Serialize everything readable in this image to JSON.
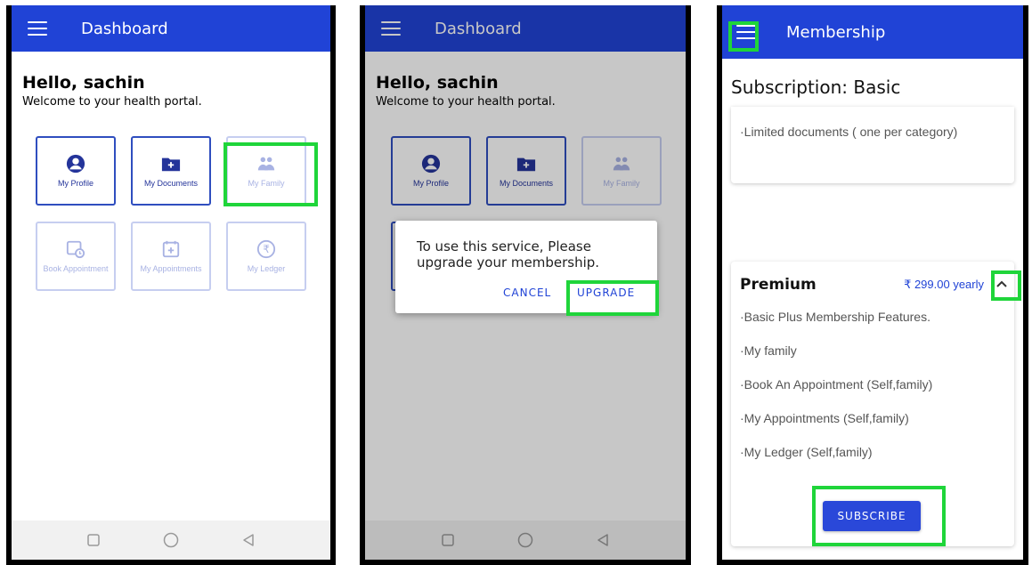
{
  "dashboard": {
    "title": "Dashboard",
    "greeting": "Hello, sachin",
    "welcome": "Welcome to your health portal.",
    "tiles": [
      {
        "label": "My Profile",
        "icon": "person-circle-icon",
        "enabled": true
      },
      {
        "label": "My Documents",
        "icon": "folder-plus-icon",
        "enabled": true
      },
      {
        "label": "My Family",
        "icon": "family-group-icon",
        "enabled": false
      },
      {
        "label": "Book Appointment",
        "icon": "calendar-clock-icon",
        "enabled": false
      },
      {
        "label": "My Appointments",
        "icon": "calendar-plus-icon",
        "enabled": false
      },
      {
        "label": "My Ledger",
        "icon": "rupee-circle-icon",
        "enabled": false
      }
    ]
  },
  "dialog": {
    "message": "To use this service, Please upgrade your membership.",
    "cancel_label": "CANCEL",
    "upgrade_label": "UPGRADE"
  },
  "membership": {
    "title": "Membership",
    "subscription": "Subscription: Basic",
    "basic_feature": "·Limited documents ( one per category)",
    "premium": {
      "name": "Premium",
      "price": "₹ 299.00 yearly",
      "features": [
        "·Basic Plus Membership Features.",
        "·My family",
        "·Book An Appointment (Self,family)",
        "·My Appointments (Self,family)",
        "·My Ledger (Self,family)"
      ]
    },
    "subscribe_label": "SUBSCRIBE"
  },
  "navbar": {
    "icons": [
      "square-icon",
      "circle-icon",
      "triangle-back-icon"
    ]
  },
  "colors": {
    "primary": "#2043d6",
    "highlight": "#1fd53a",
    "tile_border": "#2f4ebf",
    "tile_border_disabled": "#c6cef0"
  }
}
